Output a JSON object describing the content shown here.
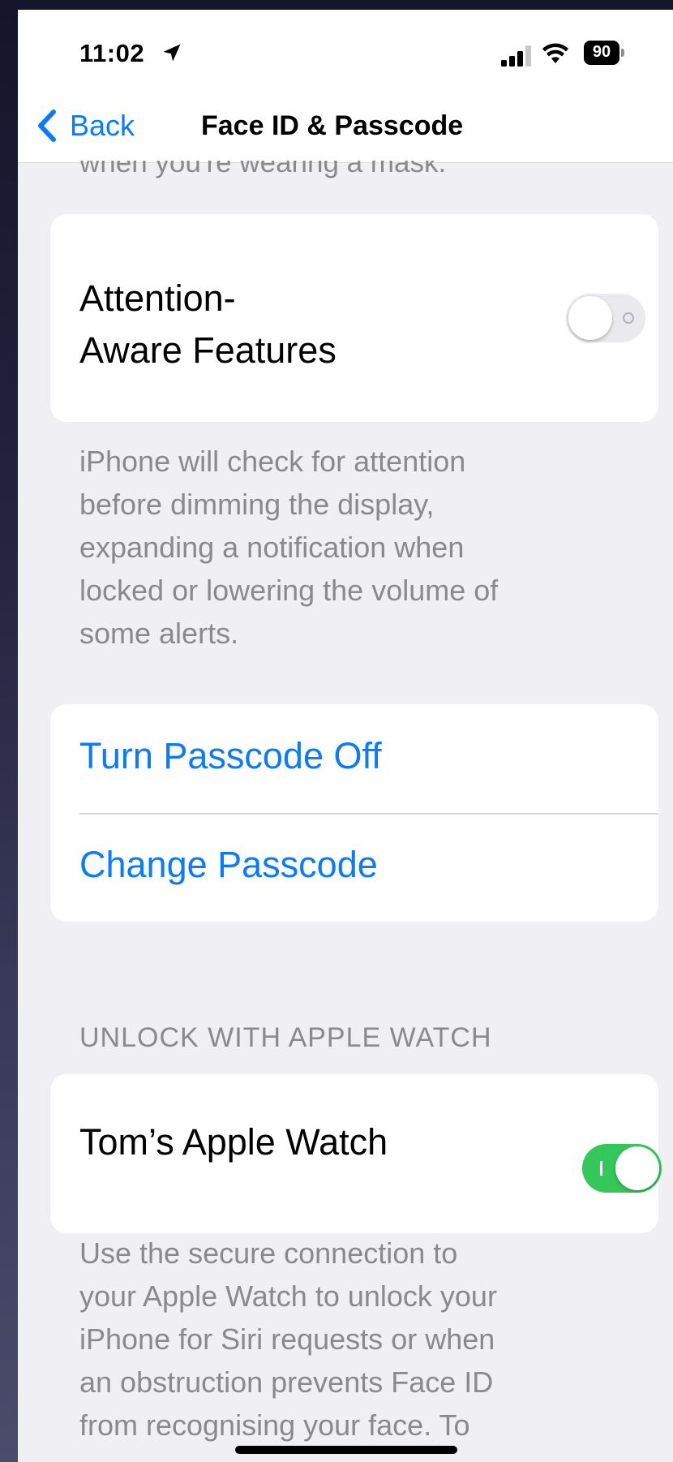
{
  "status_bar": {
    "time": "11:02",
    "battery_level": "90"
  },
  "nav": {
    "back_label": "Back",
    "title": "Face ID & Passcode"
  },
  "clipped_text": "when you're wearing a mask.",
  "attention": {
    "label_line1": "Attention-",
    "label_line2": "Aware Features",
    "enabled": false,
    "footnote_lines": [
      "iPhone will check for attention",
      "before dimming the display,",
      "expanding a notification when",
      "locked or lowering the volume of",
      "some alerts."
    ]
  },
  "passcode": {
    "turn_off_label": "Turn Passcode Off",
    "change_label": "Change Passcode"
  },
  "apple_watch": {
    "section_header": "UNLOCK WITH APPLE WATCH",
    "device_label": "Tom’s Apple Watch",
    "enabled": true,
    "footnote_lines": [
      "Use the secure connection to",
      "your Apple Watch to unlock your",
      "iPhone for Siri requests or when",
      "an obstruction prevents Face ID",
      "from recognising your face. To"
    ]
  },
  "colors": {
    "accent": "#0a7aff",
    "toggle_on": "#34c759",
    "toggle_off": "#e9e9ee",
    "group_background": "#efeff4",
    "secondary_text": "#8a8a8e"
  },
  "icons": [
    "location-arrow-icon",
    "cellular-signal-icon",
    "wifi-icon",
    "battery-icon",
    "chevron-left-icon"
  ]
}
